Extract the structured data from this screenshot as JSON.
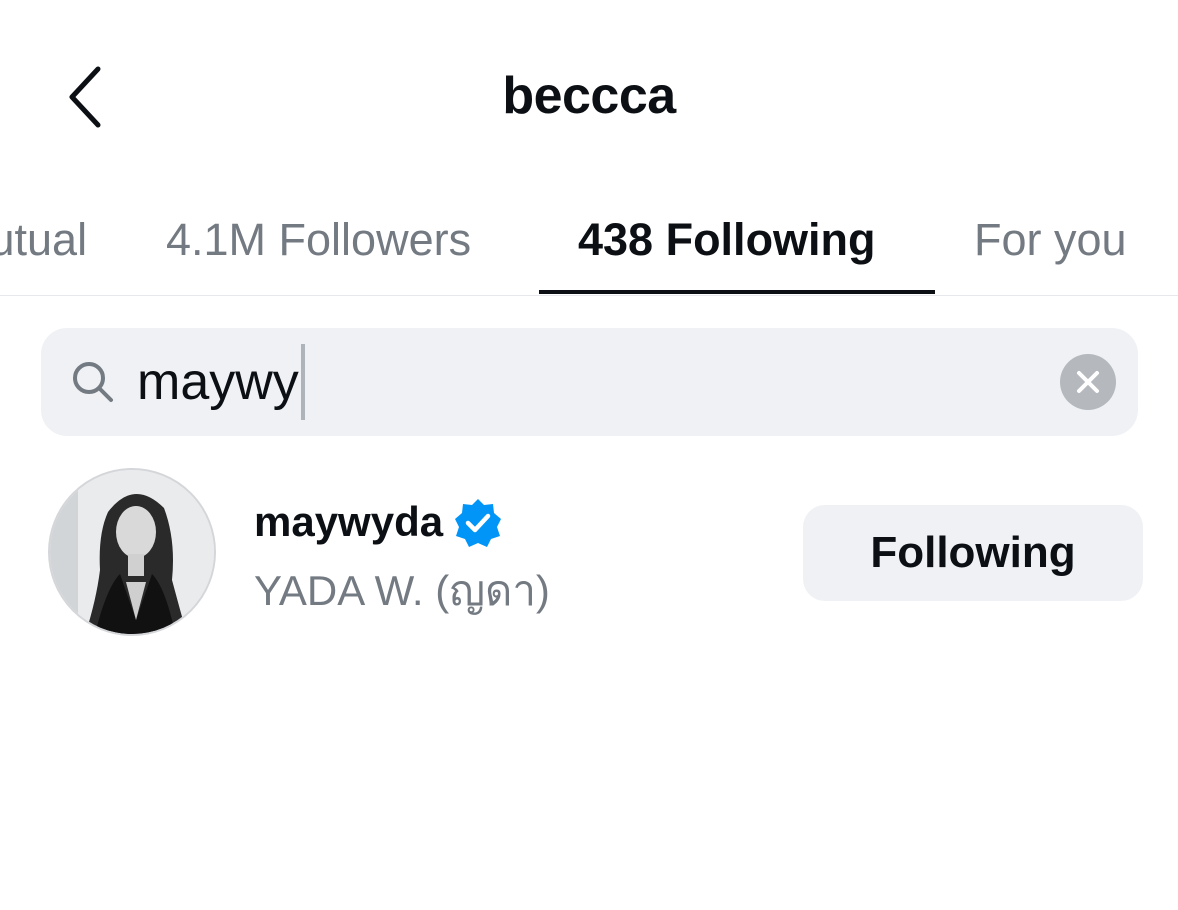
{
  "header": {
    "title": "beccca"
  },
  "tabs": [
    {
      "label": "Mutual",
      "active": false
    },
    {
      "label": "4.1M Followers",
      "active": false
    },
    {
      "label": "438 Following",
      "active": true
    },
    {
      "label": "For you",
      "active": false
    }
  ],
  "search": {
    "query": "maywy",
    "icon": "search-icon",
    "clear_icon": "close-icon"
  },
  "results": [
    {
      "username": "maywyda",
      "verified": true,
      "full_name": "YADA W. (ญดา)",
      "button_label": "Following"
    }
  ],
  "colors": {
    "text_primary": "#0c1014",
    "text_secondary": "#737a82",
    "surface": "#eff1f4",
    "verified_blue": "#0095f6"
  }
}
